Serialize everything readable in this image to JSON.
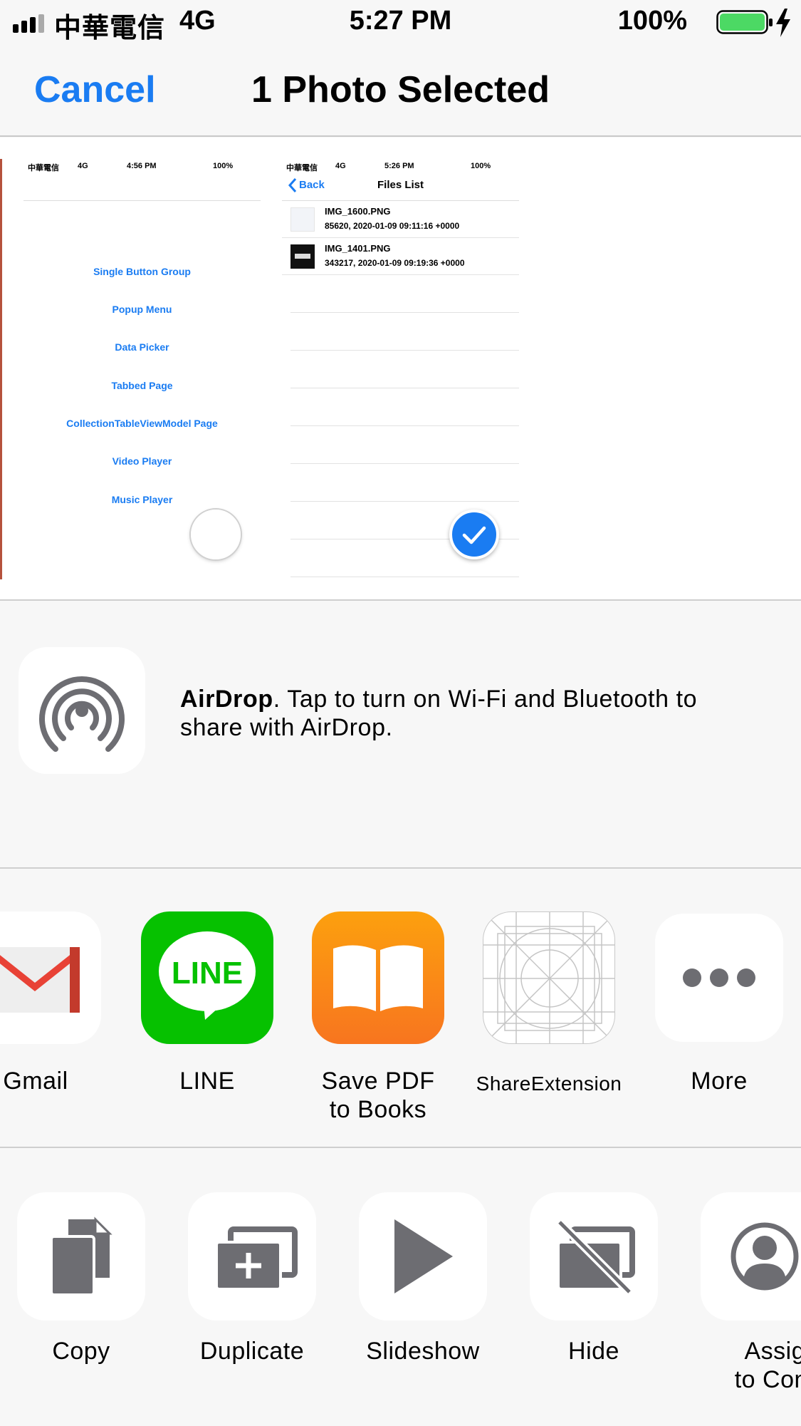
{
  "status_bar": {
    "carrier": "中華電信",
    "network": "4G",
    "time": "5:27 PM",
    "battery": "100%"
  },
  "nav": {
    "cancel": "Cancel",
    "title": "1 Photo Selected"
  },
  "photos": {
    "left_screenshot": {
      "carrier": "中華電信",
      "network": "4G",
      "time": "4:56 PM",
      "battery": "100%",
      "links": [
        "Single Button Group",
        "Popup Menu",
        "Data Picker",
        "Tabbed Page",
        "CollectionTableViewModel Page",
        "Video Player",
        "Music Player"
      ]
    },
    "right_screenshot": {
      "carrier": "中華電信",
      "network": "4G",
      "time": "5:26 PM",
      "battery": "100%",
      "back": "Back",
      "title": "Files List",
      "files": [
        {
          "name": "IMG_1600.PNG",
          "detail": "85620,  2020-01-09 09:11:16 +0000"
        },
        {
          "name": "IMG_1401.PNG",
          "detail": "343217,  2020-01-09 09:19:36 +0000"
        }
      ]
    }
  },
  "airdrop": {
    "bold": "AirDrop",
    "text": ". Tap to turn on Wi-Fi and Bluetooth to share with AirDrop."
  },
  "apps": {
    "gmail": "Gmail",
    "line": "LINE",
    "line_logo": "LINE",
    "books_line1": "Save PDF",
    "books_line2": "to Books",
    "share_extension": "ShareExtension",
    "more": "More"
  },
  "actions": {
    "copy": "Copy",
    "duplicate": "Duplicate",
    "slideshow": "Slideshow",
    "hide": "Hide",
    "assign_line1": "Assign",
    "assign_line2": "to Conta"
  },
  "colors": {
    "accent": "#1a7cf2",
    "line_green": "#06c100",
    "books_orange": "#fb8b16",
    "battery_green": "#4cd964",
    "icon_gray": "#6d6d72"
  }
}
